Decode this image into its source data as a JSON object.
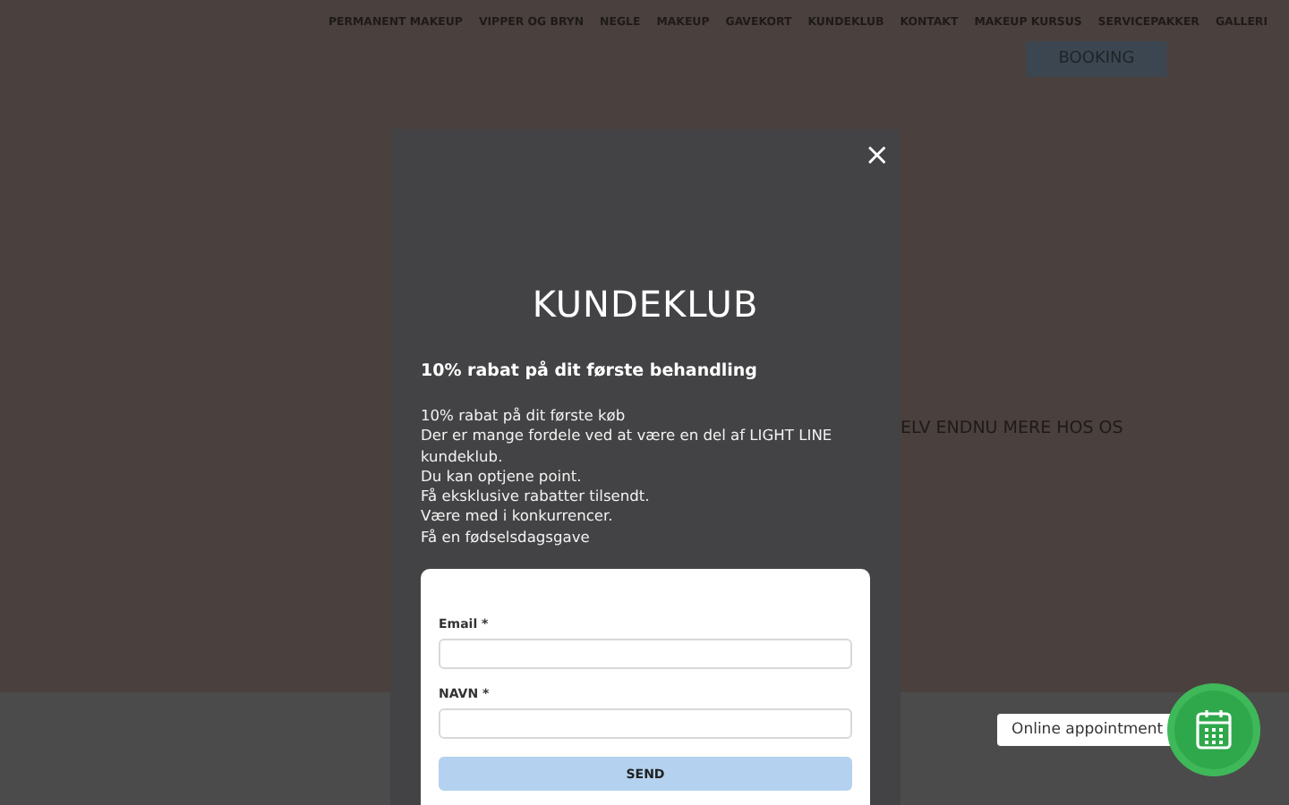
{
  "nav": {
    "items": [
      "PERMANENT MAKEUP",
      "VIPPER OG BRYN",
      "NEGLE",
      "MAKEUP",
      "GAVEKORT",
      "KUNDEKLUB",
      "KONTAKT",
      "MAKEUP KURSUS",
      "SERVICEPAKKER",
      "GALLERI"
    ],
    "booking": "BOOKING"
  },
  "background_text": "ELV ENDNU MERE HOS OS",
  "modal": {
    "close": "×",
    "title": "KUNDEKLUB",
    "subtitle": "10% rabat på dit første behandling",
    "lines": [
      "10% rabat på dit første køb",
      "Der er mange fordele ved at være en del af LIGHT LINE kundeklub.",
      "Du kan optjene point.",
      "Få eksklusive rabatter tilsendt.",
      "Være med i konkurrencer.",
      "Få en fødselsdagsgave"
    ],
    "form": {
      "fields": [
        {
          "label": "Email *"
        },
        {
          "label": "NAVN *"
        }
      ],
      "submit": "SEND"
    }
  },
  "widget": {
    "label": "Online appointment"
  }
}
